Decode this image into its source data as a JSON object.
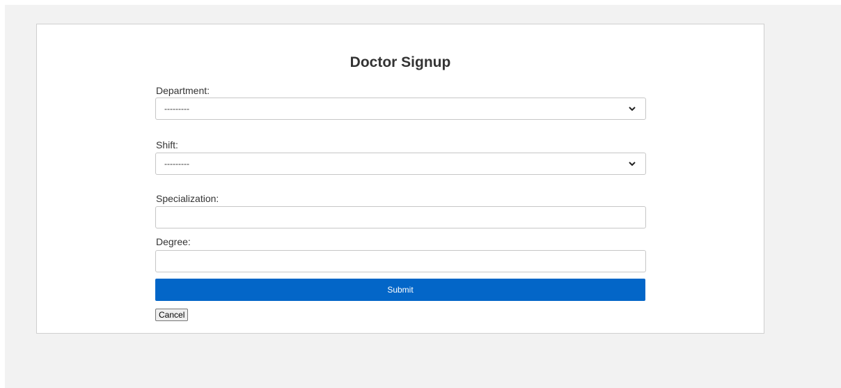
{
  "form": {
    "title": "Doctor Signup",
    "department": {
      "label": "Department:",
      "selected": "---------"
    },
    "shift": {
      "label": "Shift:",
      "selected": "---------"
    },
    "specialization": {
      "label": "Specialization:",
      "value": ""
    },
    "degree": {
      "label": "Degree:",
      "value": ""
    },
    "submit_label": "Submit",
    "cancel_label": "Cancel"
  },
  "colors": {
    "page_background": "#f2f2f2",
    "card_background": "#ffffff",
    "submit_background": "#0366c8",
    "submit_text": "#ffffff"
  },
  "icons": {
    "select_arrow": "chevron-down-icon"
  }
}
